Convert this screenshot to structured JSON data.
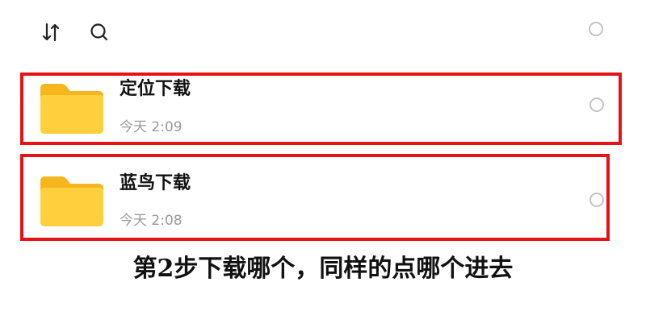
{
  "toolbar": {
    "sort_icon": "sort-arrows-icon",
    "search_icon": "search-icon"
  },
  "files": [
    {
      "name": "定位下载",
      "time": "今天 2:09",
      "icon": "folder-icon"
    },
    {
      "name": "蓝鸟下载",
      "time": "今天 2:08",
      "icon": "folder-icon"
    }
  ],
  "caption": "第2步下载哪个，同样的点哪个进去",
  "colors": {
    "highlight_border": "#e41317",
    "folder": "#ffcf3d",
    "folder_tab": "#f7b51e",
    "time_text": "#9a9a9a"
  }
}
